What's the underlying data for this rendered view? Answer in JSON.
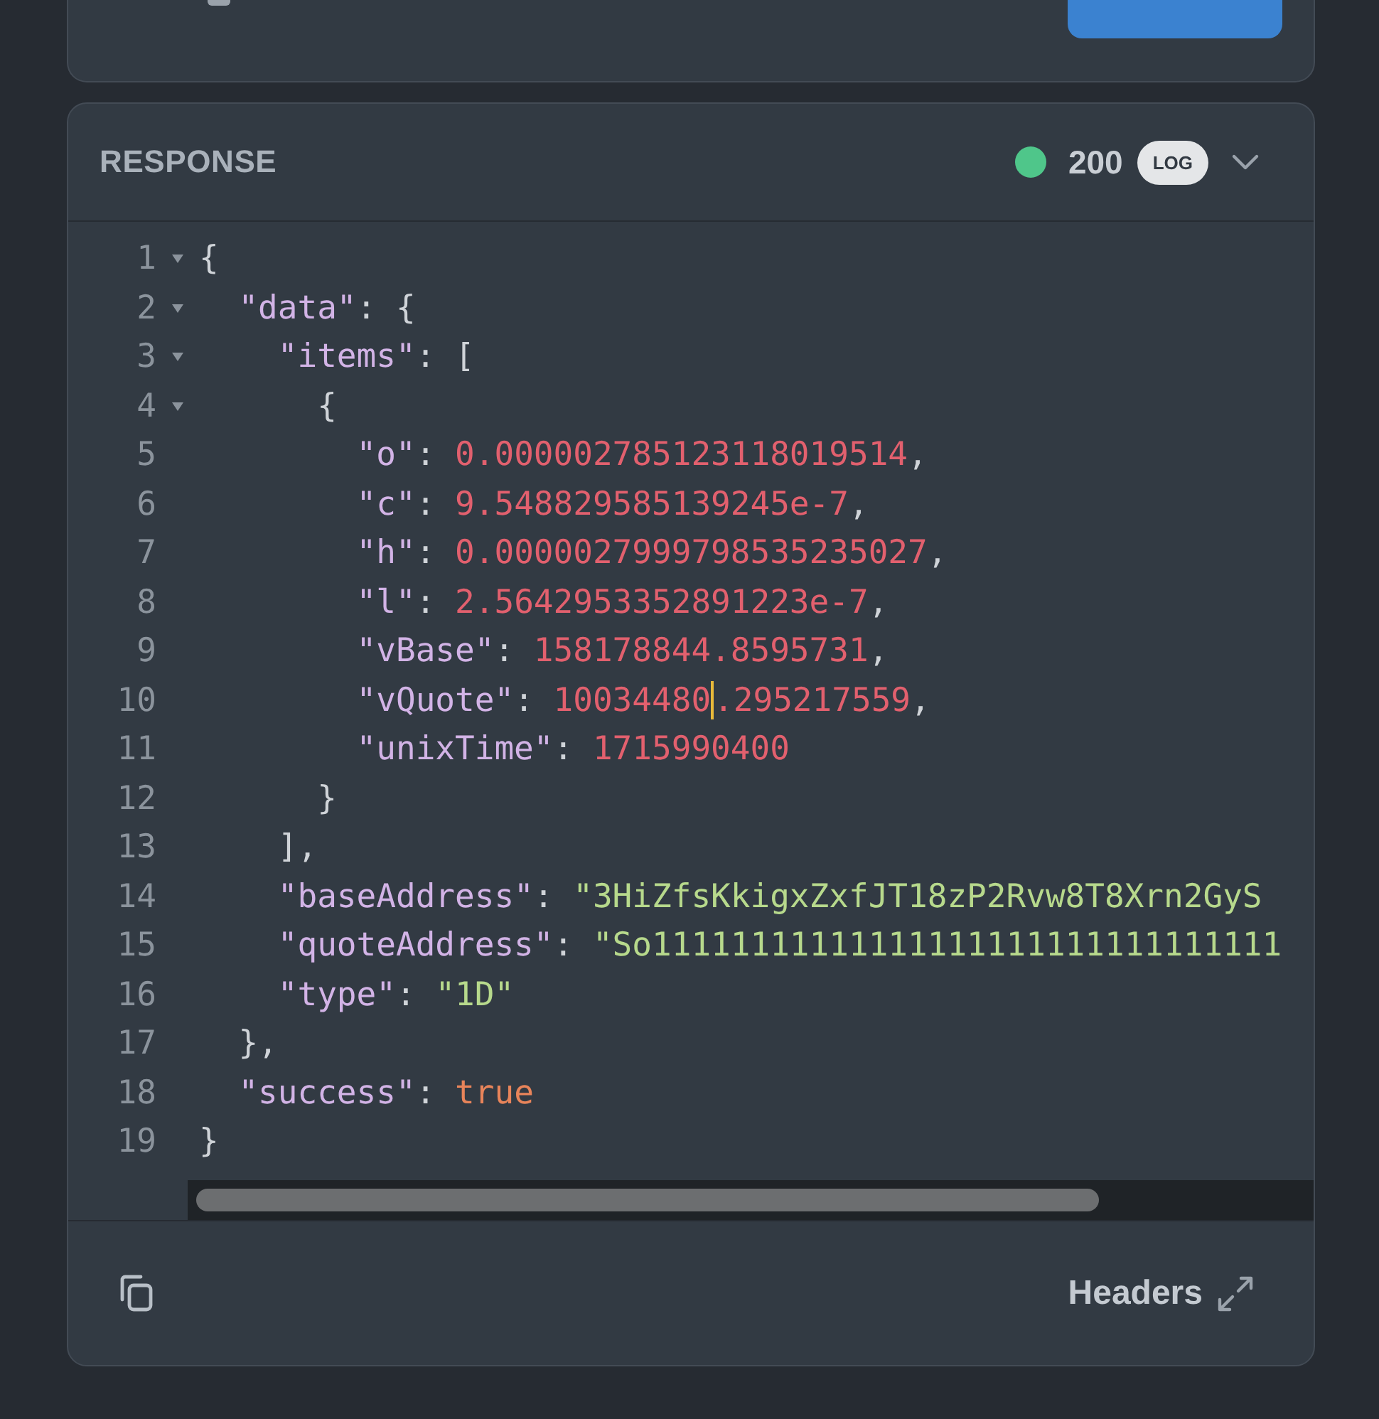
{
  "response": {
    "title": "RESPONSE",
    "status": {
      "color": "#4fc68a",
      "code": "200"
    },
    "log_badge": "LOG",
    "expanded": true,
    "lines": [
      {
        "number": "1",
        "foldable": true,
        "expanded": true,
        "tokens": [
          {
            "kind": "punct",
            "text": "{"
          }
        ]
      },
      {
        "number": "2",
        "foldable": true,
        "expanded": true,
        "tokens": [
          {
            "kind": "key",
            "text": "  \"data\""
          },
          {
            "kind": "punct",
            "text": ": {"
          }
        ]
      },
      {
        "number": "3",
        "foldable": true,
        "expanded": true,
        "tokens": [
          {
            "kind": "key",
            "text": "    \"items\""
          },
          {
            "kind": "punct",
            "text": ": ["
          }
        ]
      },
      {
        "number": "4",
        "foldable": true,
        "expanded": true,
        "tokens": [
          {
            "kind": "punct",
            "text": "      {"
          }
        ]
      },
      {
        "number": "5",
        "tokens": [
          {
            "kind": "key",
            "text": "        \"o\""
          },
          {
            "kind": "punct",
            "text": ": "
          },
          {
            "kind": "number",
            "text": "0.000002785123118019514"
          },
          {
            "kind": "punct",
            "text": ","
          }
        ]
      },
      {
        "number": "6",
        "tokens": [
          {
            "kind": "key",
            "text": "        \"c\""
          },
          {
            "kind": "punct",
            "text": ": "
          },
          {
            "kind": "number",
            "text": "9.548829585139245e-7"
          },
          {
            "kind": "punct",
            "text": ","
          }
        ]
      },
      {
        "number": "7",
        "tokens": [
          {
            "kind": "key",
            "text": "        \"h\""
          },
          {
            "kind": "punct",
            "text": ": "
          },
          {
            "kind": "number",
            "text": "0.0000027999798535235027"
          },
          {
            "kind": "punct",
            "text": ","
          }
        ]
      },
      {
        "number": "8",
        "tokens": [
          {
            "kind": "key",
            "text": "        \"l\""
          },
          {
            "kind": "punct",
            "text": ": "
          },
          {
            "kind": "number",
            "text": "2.5642953352891223e-7"
          },
          {
            "kind": "punct",
            "text": ","
          }
        ]
      },
      {
        "number": "9",
        "tokens": [
          {
            "kind": "key",
            "text": "        \"vBase\""
          },
          {
            "kind": "punct",
            "text": ": "
          },
          {
            "kind": "number",
            "text": "158178844.8595731"
          },
          {
            "kind": "punct",
            "text": ","
          }
        ]
      },
      {
        "number": "10",
        "tokens": [
          {
            "kind": "key",
            "text": "        \"vQuote\""
          },
          {
            "kind": "punct",
            "text": ": "
          },
          {
            "kind": "number",
            "text": "10034480",
            "cursor_after": true
          },
          {
            "kind": "number",
            "text": ".295217559"
          },
          {
            "kind": "punct",
            "text": ","
          }
        ]
      },
      {
        "number": "11",
        "tokens": [
          {
            "kind": "key",
            "text": "        \"unixTime\""
          },
          {
            "kind": "punct",
            "text": ": "
          },
          {
            "kind": "number",
            "text": "1715990400"
          }
        ]
      },
      {
        "number": "12",
        "tokens": [
          {
            "kind": "punct",
            "text": "      }"
          }
        ]
      },
      {
        "number": "13",
        "tokens": [
          {
            "kind": "punct",
            "text": "    ],"
          }
        ]
      },
      {
        "number": "14",
        "tokens": [
          {
            "kind": "key",
            "text": "    \"baseAddress\""
          },
          {
            "kind": "punct",
            "text": ": "
          },
          {
            "kind": "string",
            "text": "\"3HiZfsKkigxZxfJT18zP2Rvw8T8Xrn2GyS"
          }
        ]
      },
      {
        "number": "15",
        "tokens": [
          {
            "kind": "key",
            "text": "    \"quoteAddress\""
          },
          {
            "kind": "punct",
            "text": ": "
          },
          {
            "kind": "string",
            "text": "\"So11111111111111111111111111111111"
          }
        ]
      },
      {
        "number": "16",
        "tokens": [
          {
            "kind": "key",
            "text": "    \"type\""
          },
          {
            "kind": "punct",
            "text": ": "
          },
          {
            "kind": "string",
            "text": "\"1D\""
          }
        ]
      },
      {
        "number": "17",
        "tokens": [
          {
            "kind": "punct",
            "text": "  },"
          }
        ]
      },
      {
        "number": "18",
        "tokens": [
          {
            "kind": "key",
            "text": "  \"success\""
          },
          {
            "kind": "punct",
            "text": ": "
          },
          {
            "kind": "bool",
            "text": "true"
          }
        ]
      },
      {
        "number": "19",
        "tokens": [
          {
            "kind": "punct",
            "text": "}"
          }
        ]
      }
    ],
    "footer": {
      "headers_label": "Headers"
    }
  }
}
